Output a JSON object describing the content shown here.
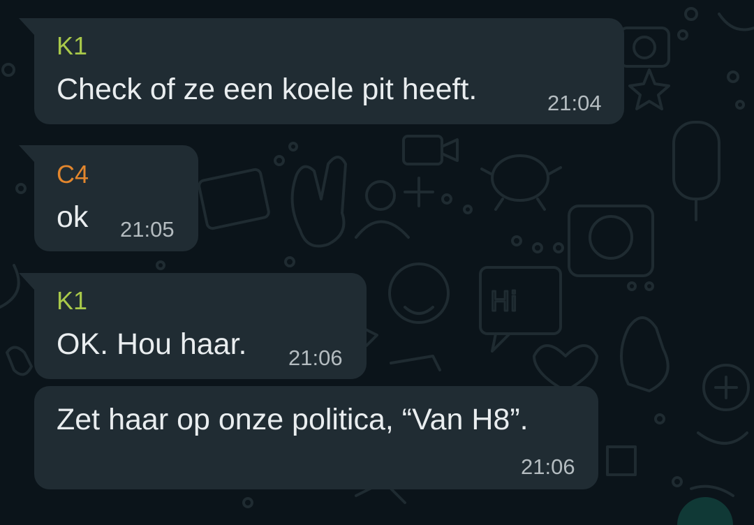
{
  "messages": [
    {
      "sender": "K1",
      "sender_color": "#a9c94a",
      "text": "Check of ze een koele pit heeft.",
      "time": "21:04"
    },
    {
      "sender": "C4",
      "sender_color": "#e2862d",
      "text": "ok",
      "time": "21:05"
    },
    {
      "sender": "K1",
      "sender_color": "#a9c94a",
      "text": "OK. Hou haar.",
      "time": "21:06"
    },
    {
      "sender": "",
      "text": "Zet haar op onze politica, “Van H8”.",
      "time": "21:06"
    }
  ],
  "wallpaper": {
    "doodle_label": "Hi",
    "pattern": "whatsapp-doodles"
  },
  "colors": {
    "background": "#0b141a",
    "bubble": "#202c33",
    "text": "#e9edef",
    "timestamp": "#b4bcc0"
  }
}
